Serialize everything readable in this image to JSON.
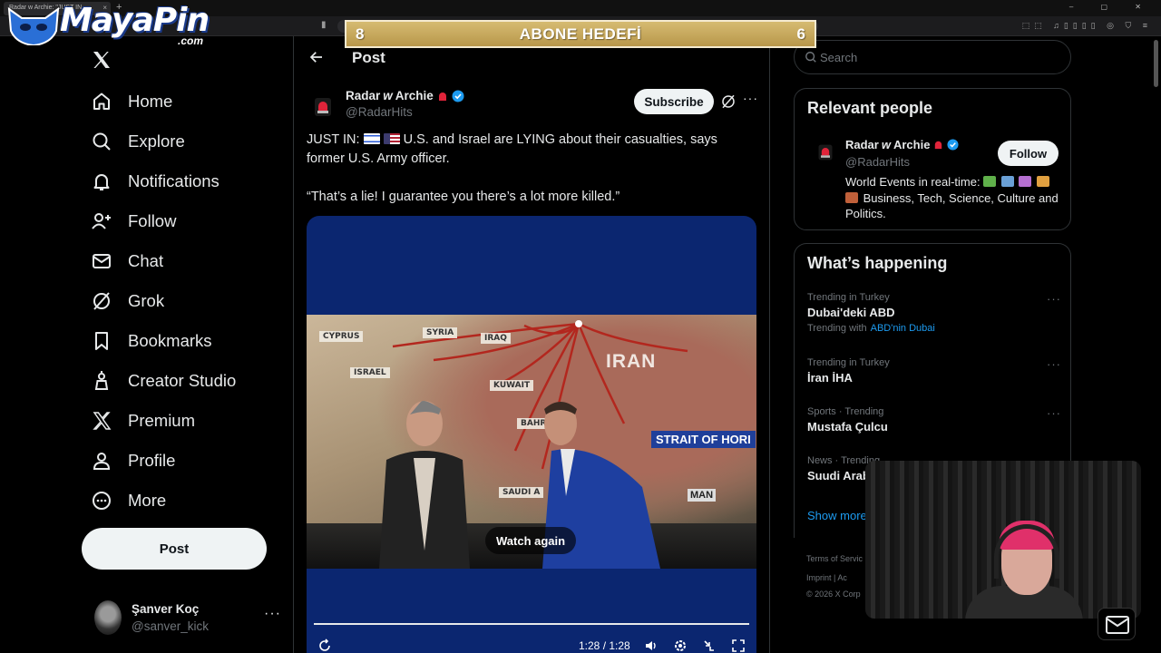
{
  "browser": {
    "tab_title": "Radar w Archie: \"JUST IN...",
    "tab_close": "×",
    "new_tab": "+",
    "window_controls": "– ▢ ✕"
  },
  "overlay": {
    "logo_name": "MayaPin",
    "logo_domain": ".com",
    "goal_left": "8",
    "goal_title": "ABONE HEDEFİ",
    "goal_right": "6"
  },
  "nav": {
    "items": [
      {
        "label": "Home",
        "icon": "home-icon"
      },
      {
        "label": "Explore",
        "icon": "search-icon"
      },
      {
        "label": "Notifications",
        "icon": "bell-icon"
      },
      {
        "label": "Follow",
        "icon": "person-add-icon"
      },
      {
        "label": "Chat",
        "icon": "mail-icon"
      },
      {
        "label": "Grok",
        "icon": "grok-icon"
      },
      {
        "label": "Bookmarks",
        "icon": "bookmark-icon"
      },
      {
        "label": "Creator Studio",
        "icon": "creator-icon"
      },
      {
        "label": "Premium",
        "icon": "x-icon"
      },
      {
        "label": "Profile",
        "icon": "person-icon"
      },
      {
        "label": "More",
        "icon": "more-circle-icon"
      }
    ],
    "post_button": "Post",
    "account": {
      "name": "Şanver Koç",
      "handle": "@sanver_kick",
      "more": "···"
    }
  },
  "post": {
    "header_title": "Post",
    "author_name": "Radar",
    "author_name_w": "w",
    "author_name_tail": "Archie",
    "author_handle": "@RadarHits",
    "subscribe": "Subscribe",
    "more": "···",
    "text_prefix": "JUST IN:",
    "text_main": " U.S. and Israel are LYING about their casualties, says former U.S. Army officer.",
    "text_quote": "“That’s a lie! I guarantee you there’s a lot more killed.”",
    "video": {
      "watch_again": "Watch again",
      "time": "1:28 / 1:28",
      "map_labels": {
        "cyprus": "CYPRUS",
        "syria": "SYRIA",
        "israel": "ISRAEL",
        "iraq": "IRAQ",
        "kuwait": "KUWAIT",
        "bahrain": "BAHRA",
        "saudi": "SAUDI A",
        "iran": "IRAN",
        "strait": "STRAIT OF HORI",
        "oman": "MAN"
      },
      "progress": 1.0
    }
  },
  "sidebar": {
    "search_placeholder": "Search",
    "relevant": {
      "title": "Relevant people",
      "name": "Radar",
      "name_w": "w",
      "name_tail": "Archie",
      "handle": "@RadarHits",
      "follow": "Follow",
      "bio_1": "World Events in real-time:",
      "bio_2": "Business, Tech, Science, Culture and Politics."
    },
    "happening": {
      "title": "What’s happening",
      "trends": [
        {
          "context": "Trending in Turkey",
          "topic": "Dubai'deki ABD",
          "with_label": "Trending with",
          "with_value": "ABD'nin Dubai"
        },
        {
          "context": "Trending in Turkey",
          "topic": "İran İHA"
        },
        {
          "context": "Sports · Trending",
          "topic": "Mustafa Çulcu"
        },
        {
          "context": "News · Trending",
          "topic": "Suudi Arab"
        }
      ],
      "show_more": "Show more",
      "more": "···"
    },
    "footer": {
      "line1": "Terms of Servic",
      "line2": "Imprint  |  Ac",
      "line3": "© 2026 X Corp"
    }
  }
}
